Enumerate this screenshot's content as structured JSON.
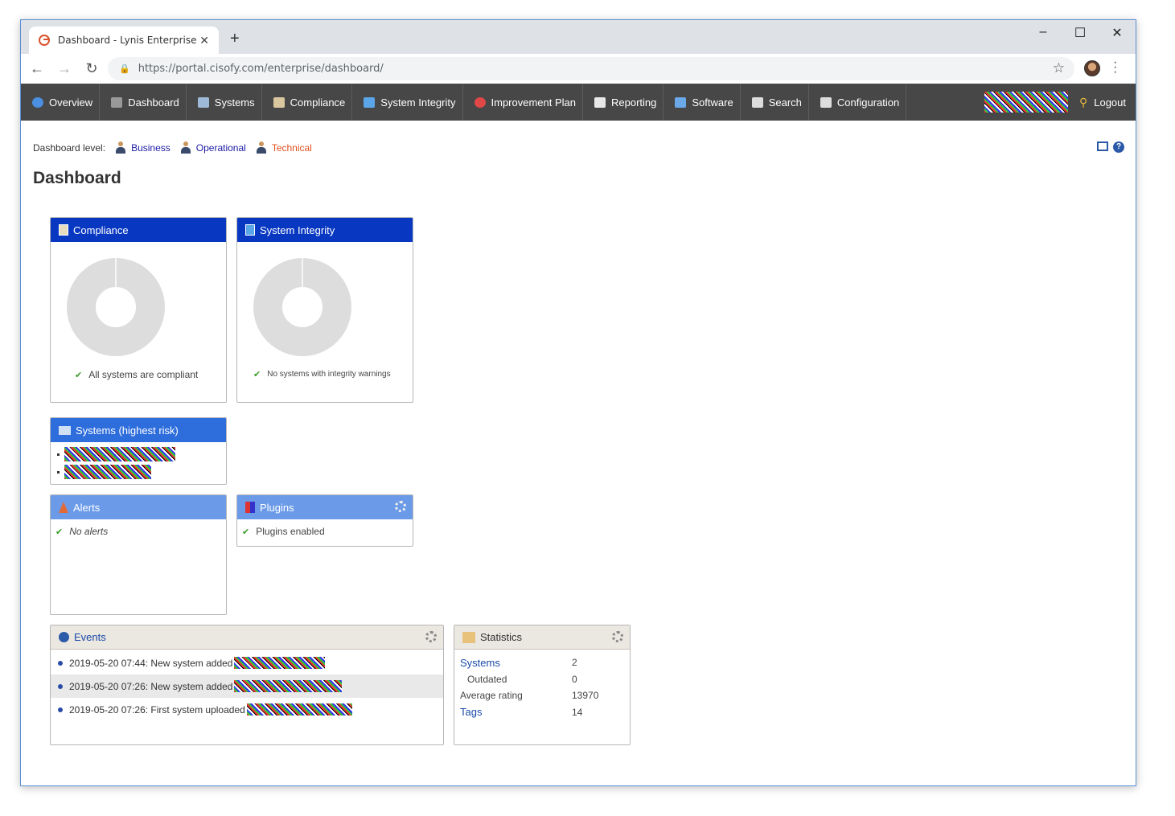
{
  "browser": {
    "tab_title": "Dashboard - Lynis Enterprise",
    "url_host": "https://portal.cisofy.com",
    "url_path": "/enterprise/dashboard/"
  },
  "nav": {
    "items": [
      {
        "label": "Overview",
        "icon": "globe-icon",
        "color": "#4a8fe0"
      },
      {
        "label": "Dashboard",
        "icon": "gauge-icon",
        "color": "#999999"
      },
      {
        "label": "Systems",
        "icon": "monitor-icon",
        "color": "#9fb9d9"
      },
      {
        "label": "Compliance",
        "icon": "clipboard-icon",
        "color": "#d9c7a0"
      },
      {
        "label": "System Integrity",
        "icon": "documents-icon",
        "color": "#5ba6e8"
      },
      {
        "label": "Improvement Plan",
        "icon": "target-icon",
        "color": "#e04848"
      },
      {
        "label": "Reporting",
        "icon": "report-icon",
        "color": "#e8e8e8"
      },
      {
        "label": "Software",
        "icon": "software-icon",
        "color": "#6aa8e8"
      },
      {
        "label": "Search",
        "icon": "keyboard-icon",
        "color": "#dddddd"
      },
      {
        "label": "Configuration",
        "icon": "gear-icon",
        "color": "#dddddd"
      }
    ],
    "logout": "Logout"
  },
  "levelbar": {
    "label": "Dashboard level:",
    "levels": [
      "Business",
      "Operational",
      "Technical"
    ],
    "active": "Technical"
  },
  "page_title": "Dashboard",
  "panels": {
    "compliance": {
      "title": "Compliance",
      "status": "All systems are compliant"
    },
    "integrity": {
      "title": "System Integrity",
      "status": "No systems with integrity warnings"
    },
    "systems_risk": {
      "title": "Systems (highest risk)"
    },
    "alerts": {
      "title": "Alerts",
      "status": "No alerts"
    },
    "plugins": {
      "title": "Plugins",
      "status": "Plugins enabled"
    },
    "events": {
      "title": "Events",
      "rows": [
        "2019-05-20 07:44: New system added",
        "2019-05-20 07:26: New system added",
        "2019-05-20 07:26: First system uploaded"
      ]
    },
    "statistics": {
      "title": "Statistics",
      "rows": [
        {
          "label": "Systems",
          "value": "2"
        },
        {
          "label": "Outdated",
          "value": "0"
        },
        {
          "label": "Average rating",
          "value": "13970"
        },
        {
          "label": "Tags",
          "value": "14"
        }
      ]
    }
  },
  "colors": {
    "nav_bg": "#474747",
    "panel_dark": "#0838c2",
    "panel_mid": "#2e6ddc",
    "panel_light": "#6b9be8",
    "active_level": "#e0501e",
    "donut": "#dddddd"
  }
}
